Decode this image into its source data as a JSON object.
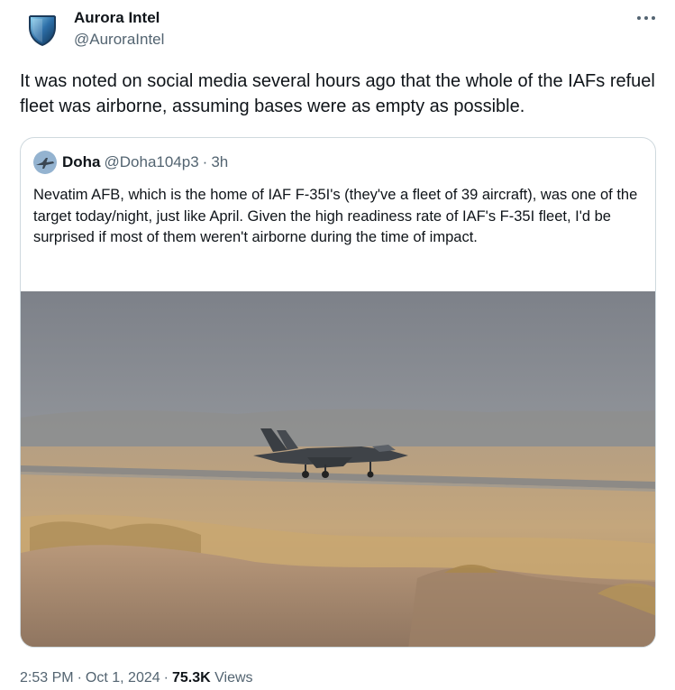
{
  "author": {
    "display_name": "Aurora Intel",
    "handle": "@AuroraIntel"
  },
  "tweet": {
    "text": "It was noted on social media several hours ago that the whole of the IAFs refuel fleet was airborne, assuming bases were as empty as possible.",
    "time": "2:53 PM",
    "date": "Oct 1, 2024",
    "views_count": "75.3K",
    "views_label": "Views",
    "separator": "·"
  },
  "quoted_tweet": {
    "display_name": "Doha",
    "handle": "@Doha104p3",
    "separator": "·",
    "time_ago": "3h",
    "text": "Nevatim AFB, which is the home of IAF F-35I's (they've a fleet of 39 aircraft), was one of the target today/night, just like April. Given the high readiness rate of IAF's F-35I fleet, I'd be surprised if most of them weren't airborne during the time of impact.",
    "media_icon": "photo-f35-on-runway"
  },
  "icons": {
    "more": "more-horizontal-icon",
    "author_avatar": "shield-logo-icon",
    "quoted_avatar": "jet-avatar-icon"
  },
  "colors": {
    "text_primary": "#0f1419",
    "text_secondary": "#536471",
    "border": "#cfd9de",
    "shield_blue": "#2d6fa8"
  }
}
